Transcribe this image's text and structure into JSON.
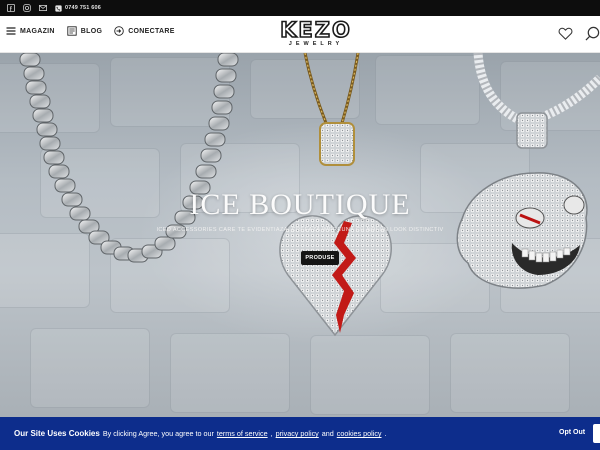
{
  "topbar": {
    "icons": [
      "facebook-icon",
      "instagram-icon",
      "mail-icon"
    ],
    "phone": "0749 751 606"
  },
  "header": {
    "nav": [
      {
        "label": "MAGAZIN",
        "icon": "menu-icon"
      },
      {
        "label": "BLOG",
        "icon": "blog-icon"
      },
      {
        "label": "CONECTARE",
        "icon": "login-icon"
      }
    ],
    "logo": {
      "main": "KEZO",
      "sub": "JEWELRY"
    },
    "right_icons": [
      "heart-icon",
      "search-icon"
    ]
  },
  "hero": {
    "title": "ICE BOUTIQUE",
    "subtitle": "Iced Accessories Care Te Evidentiaza, Creeaza Impreuna Cu Noi Un Look Distinctiv",
    "button": "PRODUSE"
  },
  "cookie": {
    "title": "Our Site Uses Cookies",
    "text": "By clicking Agree, you agree to our",
    "link_terms": "terms of service",
    "comma": ",",
    "link_privacy": "privacy policy",
    "and": "and",
    "link_cookies": "cookies policy",
    "period": ".",
    "optout": "Opt Out"
  },
  "colors": {
    "topbar": "#0d0d0d",
    "cookie_bar": "#0d2d8c",
    "button": "#151515"
  }
}
